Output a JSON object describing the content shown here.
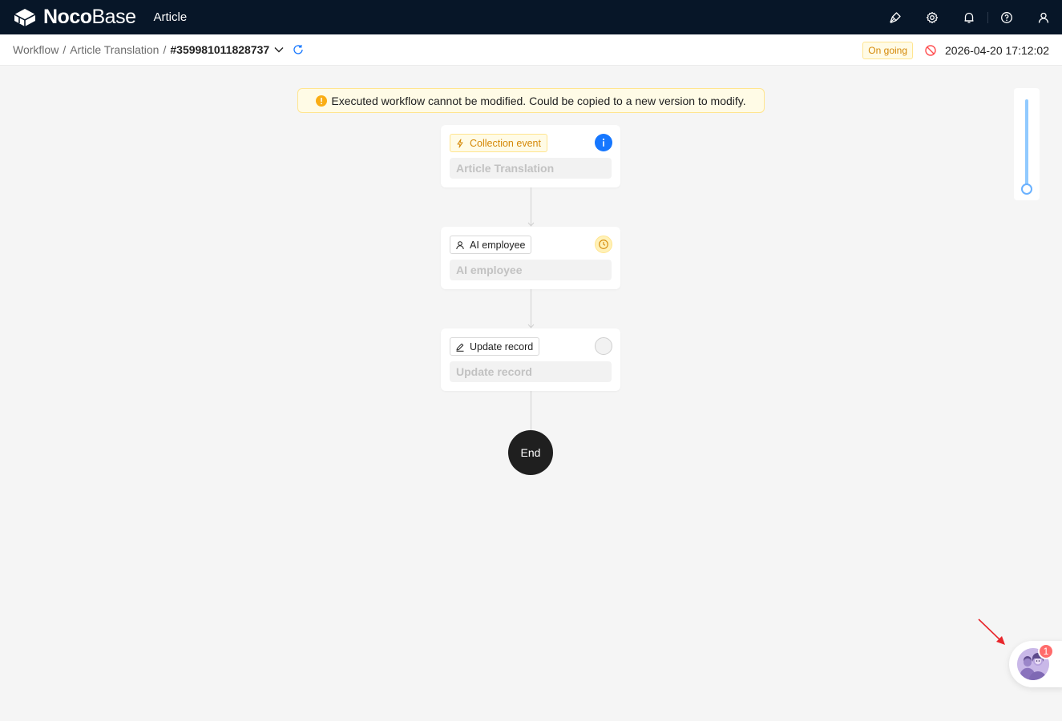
{
  "app": {
    "logo_bold": "Noco",
    "logo_light": "Base",
    "title": "Article"
  },
  "topbar": {
    "icons": [
      "theme-brush-icon",
      "settings-gear-icon",
      "notification-bell-icon",
      "help-question-icon",
      "user-profile-icon"
    ]
  },
  "breadcrumb": {
    "items": [
      "Workflow",
      "Article Translation"
    ],
    "separator": "/",
    "current": "#359981011828737"
  },
  "execution": {
    "status": "On going",
    "time": "2026-04-20 17:12:02"
  },
  "alert": {
    "message": "Executed workflow cannot be modified. Could be copied to a new version to modify."
  },
  "nodes": [
    {
      "type": "Collection event",
      "title": "Article Translation",
      "status": "info",
      "icon": "lightning-icon"
    },
    {
      "type": "AI employee",
      "title": "AI employee",
      "status": "pending",
      "icon": "person-icon"
    },
    {
      "type": "Update record",
      "title": "Update record",
      "status": "not-started",
      "icon": "edit-icon"
    }
  ],
  "end_label": "End",
  "ai_assistant": {
    "badge_count": "1"
  },
  "colors": {
    "topbar_bg": "#071628",
    "accent_blue": "#1677ff",
    "warning": "#d48806",
    "end_node": "#1f1f1f",
    "badge": "#ff6b6b"
  }
}
